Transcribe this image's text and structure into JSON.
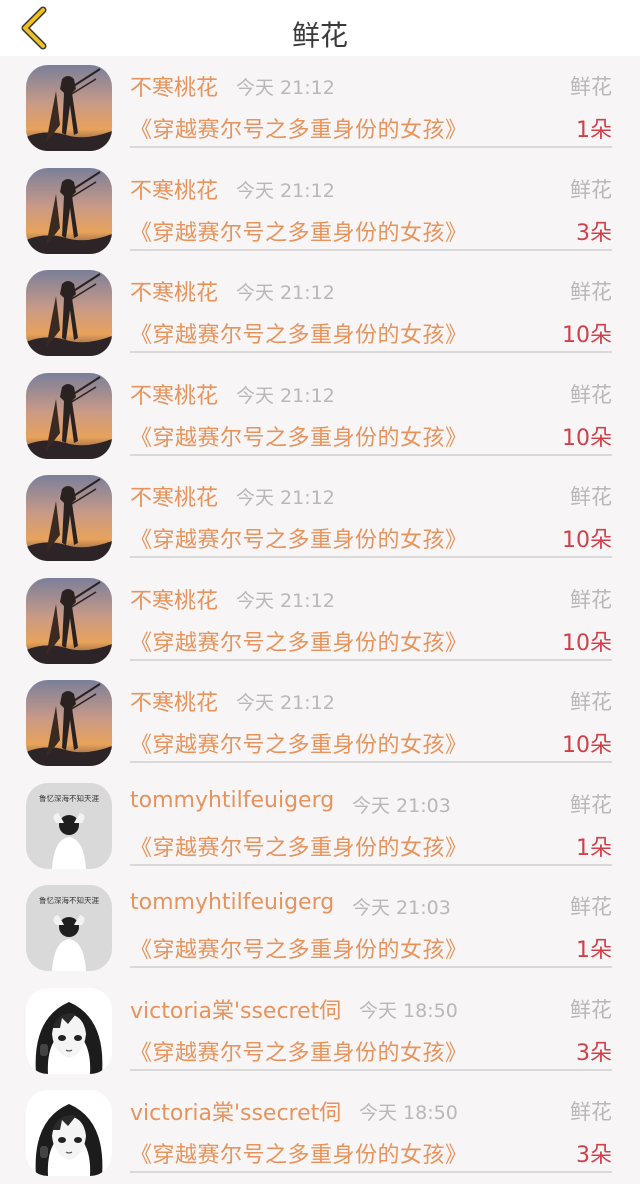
{
  "header": {
    "title": "鲜花",
    "back_icon": "chevron-left-icon",
    "accent_color": "#f0c020"
  },
  "colors": {
    "name": "#e8935b",
    "count": "#d0404a",
    "meta": "#b8b8b8"
  },
  "records": [
    {
      "name": "不寒桃花",
      "time": "今天 21:12",
      "type": "鲜花",
      "book": "《穿越赛尔号之多重身份的女孩》",
      "count": "1朵",
      "avatar": "sunset-warrior"
    },
    {
      "name": "不寒桃花",
      "time": "今天 21:12",
      "type": "鲜花",
      "book": "《穿越赛尔号之多重身份的女孩》",
      "count": "3朵",
      "avatar": "sunset-warrior"
    },
    {
      "name": "不寒桃花",
      "time": "今天 21:12",
      "type": "鲜花",
      "book": "《穿越赛尔号之多重身份的女孩》",
      "count": "10朵",
      "avatar": "sunset-warrior"
    },
    {
      "name": "不寒桃花",
      "time": "今天 21:12",
      "type": "鲜花",
      "book": "《穿越赛尔号之多重身份的女孩》",
      "count": "10朵",
      "avatar": "sunset-warrior"
    },
    {
      "name": "不寒桃花",
      "time": "今天 21:12",
      "type": "鲜花",
      "book": "《穿越赛尔号之多重身份的女孩》",
      "count": "10朵",
      "avatar": "sunset-warrior"
    },
    {
      "name": "不寒桃花",
      "time": "今天 21:12",
      "type": "鲜花",
      "book": "《穿越赛尔号之多重身份的女孩》",
      "count": "10朵",
      "avatar": "sunset-warrior"
    },
    {
      "name": "不寒桃花",
      "time": "今天 21:12",
      "type": "鲜花",
      "book": "《穿越赛尔号之多重身份的女孩》",
      "count": "10朵",
      "avatar": "sunset-warrior"
    },
    {
      "name": "tommyhtilfeuigerg",
      "time": "今天 21:03",
      "type": "鲜花",
      "book": "《穿越赛尔号之多重身份的女孩》",
      "count": "1朵",
      "avatar": "gray-figure",
      "avatar_caption": "鲁忆深海不知天涯"
    },
    {
      "name": "tommyhtilfeuigerg",
      "time": "今天 21:03",
      "type": "鲜花",
      "book": "《穿越赛尔号之多重身份的女孩》",
      "count": "1朵",
      "avatar": "gray-figure",
      "avatar_caption": "鲁忆深海不知天涯"
    },
    {
      "name": "victoria棠'ssecret伺",
      "time": "今天 18:50",
      "type": "鲜花",
      "book": "《穿越赛尔号之多重身份的女孩》",
      "count": "3朵",
      "avatar": "anime-girl"
    },
    {
      "name": "victoria棠'ssecret伺",
      "time": "今天 18:50",
      "type": "鲜花",
      "book": "《穿越赛尔号之多重身份的女孩》",
      "count": "3朵",
      "avatar": "anime-girl"
    }
  ]
}
